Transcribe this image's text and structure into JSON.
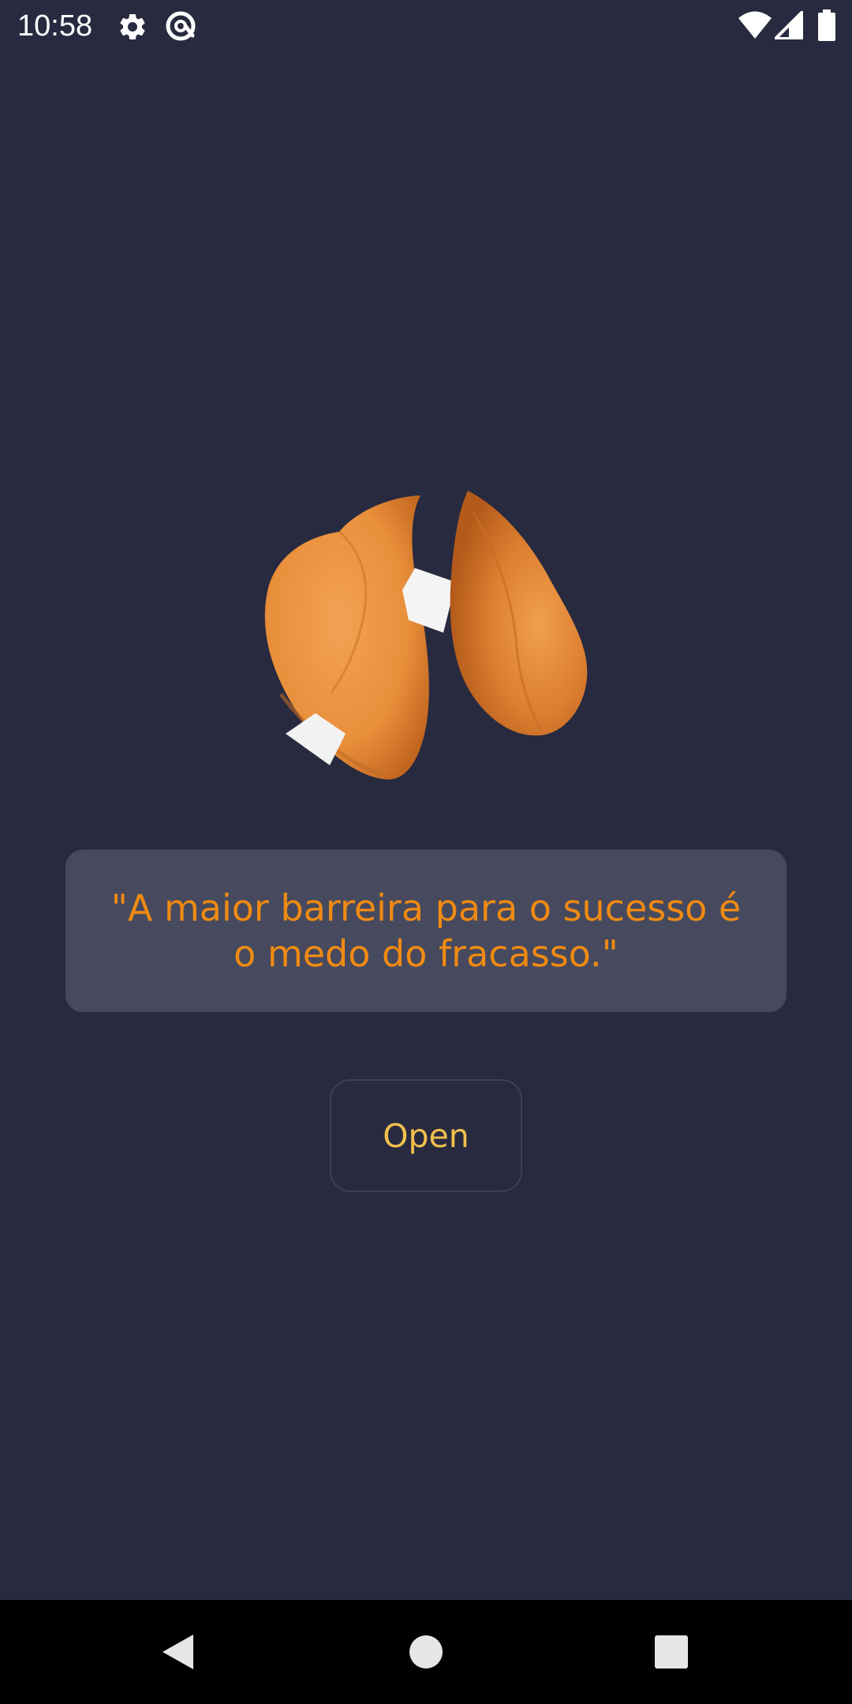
{
  "status_bar": {
    "time": "10:58",
    "icons": [
      "gear-icon",
      "at-sign-icon",
      "wifi-icon",
      "signal-icon",
      "battery-icon"
    ]
  },
  "main": {
    "image": "fortune-cookie-icon",
    "fortune_text": "\"A maior barreira para o sucesso é o medo do fracasso.\"",
    "open_button_label": "Open"
  },
  "navigation_bar": {
    "buttons": [
      "back-icon",
      "home-icon",
      "recents-icon"
    ]
  },
  "colors": {
    "background": "#282a3f",
    "card": "#474a5e",
    "fortune_text": "#f08a12",
    "button_text": "#f2c04d",
    "button_border": "#3b4257",
    "navbar": "#000000"
  }
}
